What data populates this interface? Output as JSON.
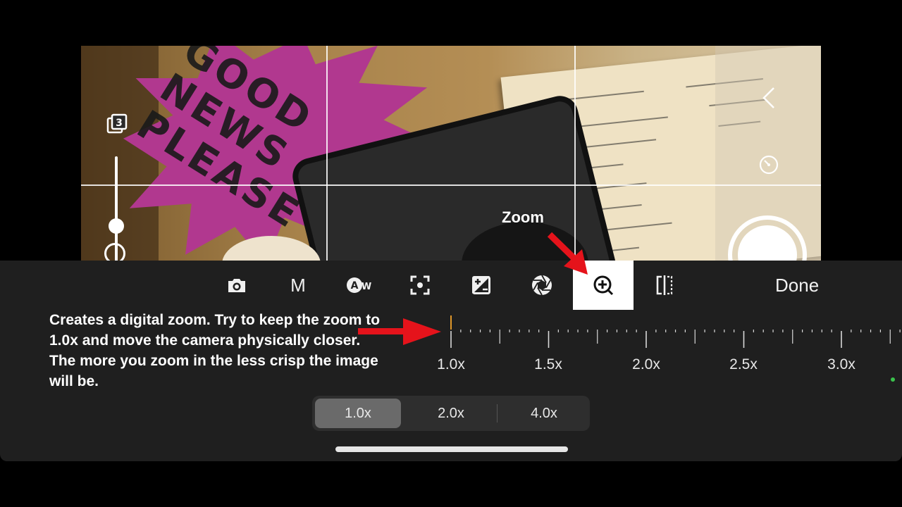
{
  "viewfinder": {
    "sign_words": [
      "GOOD",
      "NEWS",
      "PLEASE"
    ]
  },
  "annotations": {
    "zoom_callout": "Zoom",
    "help_text": "Creates a digital zoom. Try to keep the zoom to 1.0x and move the camera physically closer. The more you zoom in the less crisp the image will be.",
    "arrow_color": "#e5131b"
  },
  "toolbar": {
    "items": [
      {
        "name": "camera-mode",
        "icon": "camera-icon"
      },
      {
        "name": "manual-mode",
        "label": "M",
        "icon": "manual-icon"
      },
      {
        "name": "white-balance",
        "icon": "auto-white-balance-icon"
      },
      {
        "name": "focus",
        "icon": "focus-icon"
      },
      {
        "name": "exposure",
        "icon": "exposure-icon"
      },
      {
        "name": "aperture",
        "icon": "aperture-icon"
      },
      {
        "name": "zoom",
        "icon": "zoom-in-icon",
        "active": true
      },
      {
        "name": "mirror",
        "icon": "mirror-icon"
      }
    ],
    "done_label": "Done"
  },
  "zoom_ruler": {
    "labels": [
      "1.0x",
      "1.5x",
      "2.0x",
      "2.5x",
      "3.0x"
    ],
    "current": "1.0x",
    "indicator_color": "#e0972a"
  },
  "zoom_presets": {
    "options": [
      "1.0x",
      "2.0x",
      "4.0x"
    ],
    "selected": "1.0x"
  },
  "colors": {
    "panel": "#1f1f1f",
    "active_tool": "#ffffff",
    "status_dot": "#3ac24c"
  }
}
